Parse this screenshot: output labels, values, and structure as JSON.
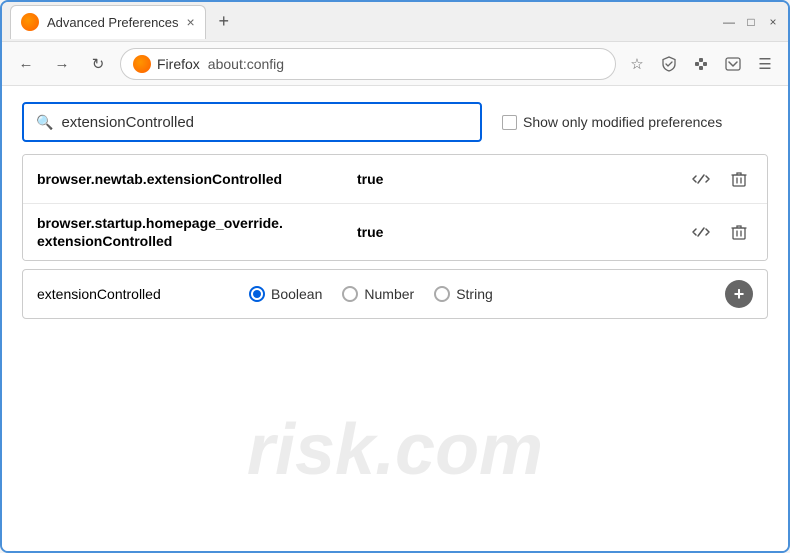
{
  "window": {
    "title": "Advanced Preferences",
    "tab_close": "×",
    "new_tab": "+"
  },
  "titlebar": {
    "tab_label": "Advanced Preferences",
    "close": "×",
    "minimize": "—",
    "maximize": "□"
  },
  "navbar": {
    "back": "←",
    "forward": "→",
    "reload": "↻",
    "firefox_label": "Firefox",
    "address": "about:config",
    "bookmark_icon": "☆",
    "shield_icon": "🛡",
    "extension_icon": "🧩",
    "menu_icon": "☰"
  },
  "search": {
    "placeholder": "extensionControlled",
    "value": "extensionControlled"
  },
  "filter": {
    "checkbox_label": "Show only modified preferences"
  },
  "preferences": [
    {
      "name": "browser.newtab.extensionControlled",
      "value": "true"
    },
    {
      "name": "browser.startup.homepage_override.\nextensionControlled",
      "name_line1": "browser.startup.homepage_override.",
      "name_line2": "extensionControlled",
      "value": "true"
    }
  ],
  "add_pref": {
    "name": "extensionControlled",
    "radio_options": [
      {
        "label": "Boolean",
        "selected": true
      },
      {
        "label": "Number",
        "selected": false
      },
      {
        "label": "String",
        "selected": false
      }
    ],
    "add_button": "+"
  },
  "watermark": "risk.com",
  "icons": {
    "arrows": "⇌",
    "trash": "🗑",
    "search": "🔍"
  }
}
